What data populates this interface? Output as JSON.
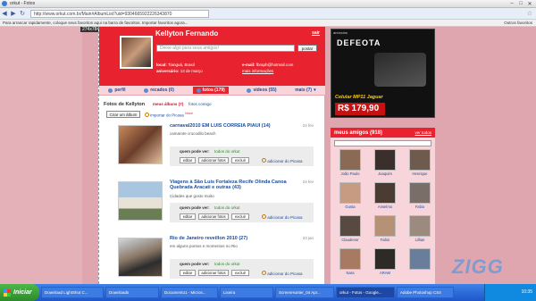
{
  "browser": {
    "tab_title": "orkut - Fotos",
    "address": "http://www.orkut.com.br/Main#AlbumList?uid=9304665922226343870",
    "bookmark_text": "Para arrancar rapidamente, coloque seus favoritos aqui na barra de favoritos. Importar favoritos agora...",
    "other_bookmarks": "Outros favoritos",
    "dimension_tag": "274x784"
  },
  "profile": {
    "name": "Kellyton Fernando",
    "sair": "sair",
    "scrap_placeholder": "Deixe algo para seus amigos!",
    "postar": "postar",
    "local_label": "local:",
    "local_value": "Tianguá, Brasil",
    "aniversario_label": "aniversário:",
    "aniversario_value": "13 de março",
    "email_label": "e-mail:",
    "email_value": "fbraph@hotmail.com",
    "mais_info": "mais informações"
  },
  "tabs": [
    {
      "label": "perfil"
    },
    {
      "label": "recados (0)"
    },
    {
      "label": "fotos (179)"
    },
    {
      "label": "vídeos (55)"
    },
    {
      "label": "mais (7)"
    }
  ],
  "content": {
    "fotos_title": "Fotos de Kellyton",
    "meus_albuns": "meus álbuns (7)",
    "fotos_comigo": "fotos comigo",
    "criar_album": "Criar um álbum",
    "importar": "importar do Picasa",
    "novo": "Novo!"
  },
  "albums": [
    {
      "title": "carnaval2010 EM LUIS CORREIA PIAUI (14)",
      "date": "24 fev",
      "desc": "camarote crocodilo beach",
      "quem_pode_ver": "quem pode ver:",
      "todos": "todos do orkut",
      "editar": "editar",
      "adicionar": "adicionar fotos",
      "excluir": "excluir",
      "picasa": "adicionar do Picasa"
    },
    {
      "title": "Viagens à São Luis Fortaleza Recife Olinda Canoa Quebrada Aracati e outras (43)",
      "date": "24 fev",
      "desc": "Cidades que gosto muito",
      "quem_pode_ver": "quem pode ver:",
      "todos": "todos do orkut",
      "editar": "editar",
      "adicionar": "adicionar fotos",
      "excluir": "excluir",
      "picasa": "adicionar do Picasa"
    },
    {
      "title": "Rio de Janeiro reveillon 2010 (27)",
      "date": "23 jan",
      "desc": "em alguns pontos e momentos no Rio",
      "quem_pode_ver": "quem pode ver:",
      "todos": "todos do orkut",
      "editar": "editar",
      "adicionar": "adicionar fotos",
      "excluir": "excluir",
      "picasa": "adicionar do Picasa"
    }
  ],
  "ad": {
    "anuncio": "anúncios",
    "brand": "DEFEOTA",
    "caption": "Celular MP11 Jaguar",
    "price": "R$ 179,90"
  },
  "friends": {
    "title": "meus amigos (918)",
    "ver_todos": "ver todos",
    "list": [
      {
        "name": "João Paulo",
        "color": "#8a6a55"
      },
      {
        "name": "Joaquim",
        "color": "#3a2f2a"
      },
      {
        "name": "Henrique",
        "color": "#6e5b4e"
      },
      {
        "name": "Gusta",
        "color": "#c79b82"
      },
      {
        "name": "Anselmo",
        "color": "#4a3b33"
      },
      {
        "name": "Fabio",
        "color": "#7a6f68"
      },
      {
        "name": "Claudenor",
        "color": "#584a40"
      },
      {
        "name": "Fabio",
        "color": "#b59176"
      },
      {
        "name": "Lillian",
        "color": "#9c8a7e"
      },
      {
        "name": "Nara",
        "color": "#a87a62"
      },
      {
        "name": "ARAM",
        "color": "#2e2a28"
      },
      {
        "name": "",
        "color": "#6a7d9a"
      }
    ]
  },
  "watermark": "ZIGG",
  "taskbar": {
    "start": "Iniciar",
    "items": [
      "Download LightShot C...",
      "Downloads",
      "Documento1 - Micros...",
      "Lixeira",
      "ScreenHunter_04 Apr...",
      "orkut - Fotos - Google...",
      "Adobe Photoshop CS4"
    ],
    "clock": "10:35"
  }
}
